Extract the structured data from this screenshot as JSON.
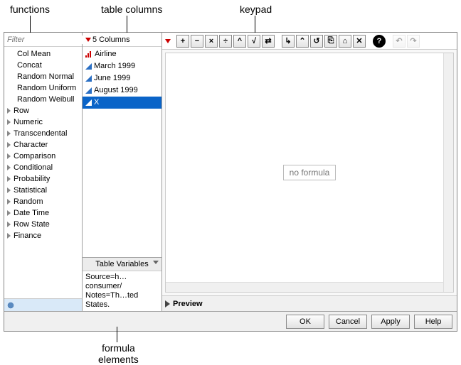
{
  "annotations": {
    "functions": "functions",
    "columns": "table columns",
    "keypad": "keypad",
    "formula_elements_l1": "formula",
    "formula_elements_l2": "elements"
  },
  "filter": {
    "placeholder": "Filter",
    "search_hint": "⌄"
  },
  "functions": {
    "recent": [
      "Col Mean",
      "Concat",
      "Random Normal",
      "Random Uniform",
      "Random Weibull"
    ],
    "groups": [
      "Row",
      "Numeric",
      "Transcendental",
      "Character",
      "Comparison",
      "Conditional",
      "Probability",
      "Statistical",
      "Random",
      "Date Time",
      "Row State",
      "Finance"
    ]
  },
  "columns": {
    "header": "5 Columns",
    "items": [
      {
        "label": "Airline",
        "icon": "nominal"
      },
      {
        "label": "March 1999",
        "icon": "continuous"
      },
      {
        "label": "June 1999",
        "icon": "continuous"
      },
      {
        "label": "August 1999",
        "icon": "continuous"
      },
      {
        "label": "X",
        "icon": "continuous",
        "selected": true
      }
    ]
  },
  "table_variables": {
    "header": "Table Variables",
    "lines": [
      "Source=h…consumer/",
      "Notes=Th…ted States."
    ]
  },
  "toolbar": {
    "buttons": [
      {
        "name": "add",
        "glyph": "+"
      },
      {
        "name": "subtract",
        "glyph": "−"
      },
      {
        "name": "multiply",
        "glyph": "×"
      },
      {
        "name": "divide",
        "glyph": "÷"
      },
      {
        "name": "power",
        "glyph": "^"
      },
      {
        "name": "root",
        "glyph": "√"
      },
      {
        "name": "switch",
        "glyph": "⇄"
      },
      {
        "name": "sep1",
        "sep": true
      },
      {
        "name": "insert",
        "glyph": "↳"
      },
      {
        "name": "peel",
        "glyph": "⌃"
      },
      {
        "name": "loop",
        "glyph": "↺"
      },
      {
        "name": "local",
        "glyph": "⎘"
      },
      {
        "name": "container",
        "glyph": "⌂"
      },
      {
        "name": "delete",
        "glyph": "✕"
      },
      {
        "name": "sep2",
        "sep": true
      },
      {
        "name": "help",
        "glyph": "?",
        "help": true
      },
      {
        "name": "sep3",
        "sep": true
      },
      {
        "name": "undo",
        "glyph": "↶",
        "disabled": true
      },
      {
        "name": "redo",
        "glyph": "↷",
        "disabled": true
      }
    ]
  },
  "formula": {
    "placeholder": "no formula"
  },
  "preview": {
    "label": "Preview"
  },
  "buttons": {
    "ok": "OK",
    "cancel": "Cancel",
    "apply": "Apply",
    "help": "Help"
  }
}
